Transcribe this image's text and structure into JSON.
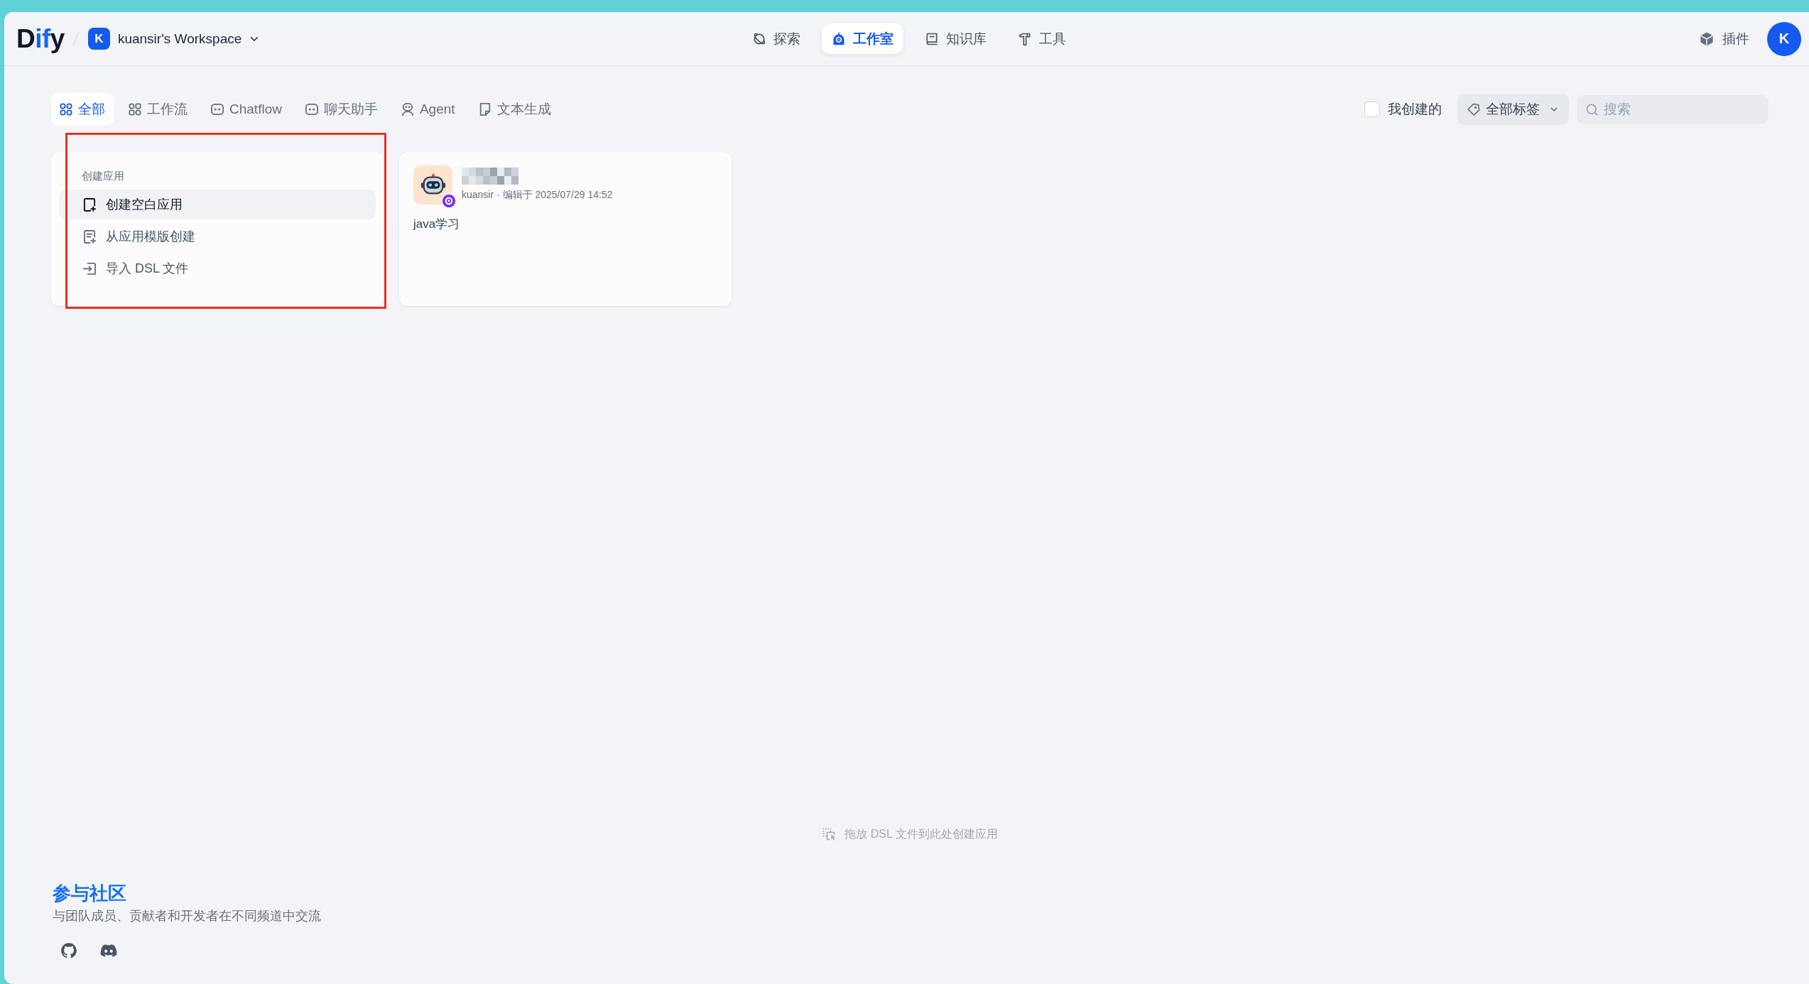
{
  "header": {
    "logo": "Dify",
    "workspace": {
      "initial": "K",
      "name": "kuansir's Workspace"
    },
    "nav": [
      {
        "label": "探索",
        "selected": false
      },
      {
        "label": "工作室",
        "selected": true
      },
      {
        "label": "知识库",
        "selected": false
      },
      {
        "label": "工具",
        "selected": false
      }
    ],
    "plugins": {
      "label": "插件"
    },
    "avatar": {
      "initial": "K"
    }
  },
  "filter_tabs": [
    {
      "label": "全部",
      "selected": true
    },
    {
      "label": "工作流",
      "selected": false
    },
    {
      "label": "Chatflow",
      "selected": false
    },
    {
      "label": "聊天助手",
      "selected": false
    },
    {
      "label": "Agent",
      "selected": false
    },
    {
      "label": "文本生成",
      "selected": false
    }
  ],
  "filters": {
    "created_by_me": {
      "label": "我创建的",
      "checked": false
    },
    "tags": {
      "label": "全部标签"
    },
    "search": {
      "placeholder": "搜索"
    }
  },
  "create_card": {
    "title": "创建应用",
    "items": [
      {
        "label": "创建空白应用",
        "selected": true
      },
      {
        "label": "从应用模版创建",
        "selected": false
      },
      {
        "label": "导入 DSL 文件",
        "selected": false
      }
    ]
  },
  "apps": [
    {
      "meta": "kuansir · 编辑于 2025/07/29 14:52",
      "description": "java学习"
    }
  ],
  "drop_hint": "拖放 DSL 文件到此处创建应用",
  "community": {
    "title": "参与社区",
    "subtitle": "与团队成员、贡献者和开发者在不同频道中交流"
  }
}
